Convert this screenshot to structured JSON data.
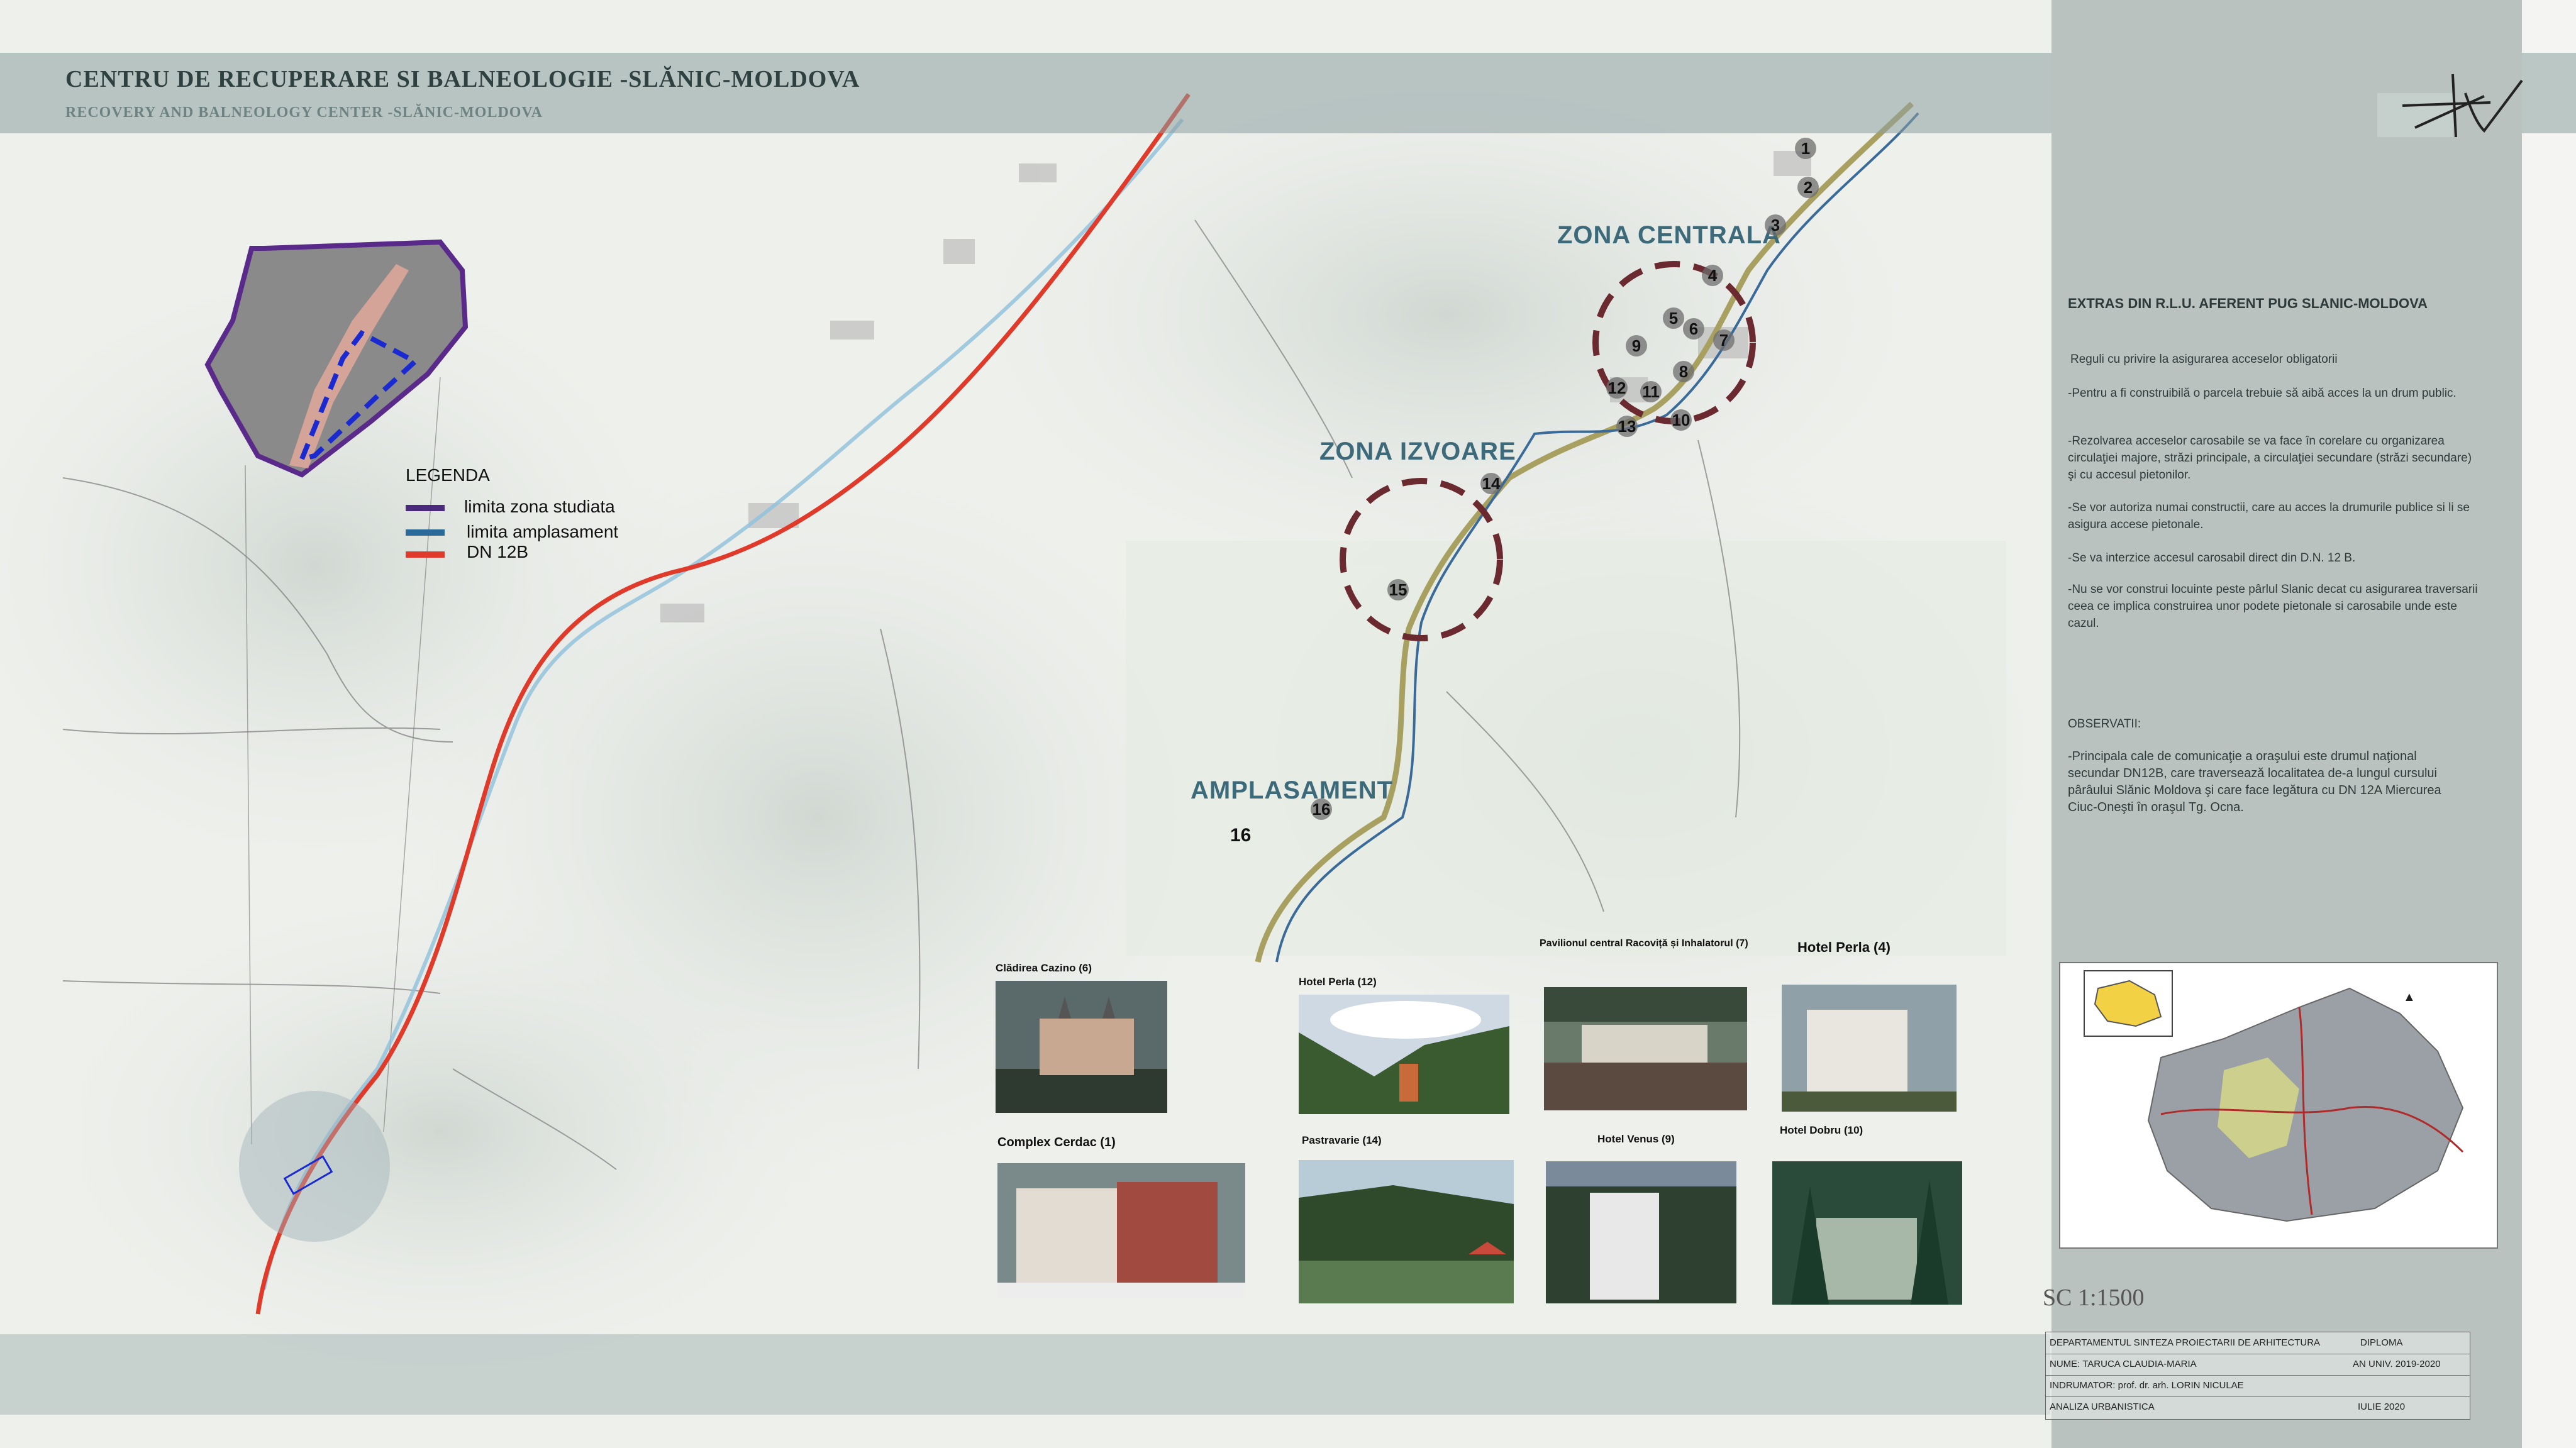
{
  "header": {
    "title": "CENTRU DE RECUPERARE SI BALNEOLOGIE -SLĂNIC-MOLDOVA",
    "subtitle": "RECOVERY AND BALNEOLOGY CENTER -SLĂNIC-MOLDOVA"
  },
  "legend": {
    "title": "LEGENDA",
    "items": [
      {
        "label": "limita zona studiata",
        "color": "#4a2a7a"
      },
      {
        "label": "limita amplasament",
        "color": "#2a6a9a"
      },
      {
        "label": "DN 12B",
        "color": "#e03a2a"
      }
    ]
  },
  "zones": {
    "centrala": "ZONA CENTRALA",
    "izvoare": "ZONA IZVOARE",
    "amplasament": "AMPLASAMENT"
  },
  "markers": [
    "1",
    "2",
    "3",
    "4",
    "5",
    "6",
    "7",
    "8",
    "9",
    "10",
    "11",
    "12",
    "13",
    "14",
    "15",
    "16",
    "16"
  ],
  "photos": [
    {
      "caption": "Clădirea Cazino (6)"
    },
    {
      "caption": "Hotel Perla (12)"
    },
    {
      "caption": "Pavilionul central Racoviță și Inhalatorul (7)"
    },
    {
      "caption": "Hotel Perla (4)"
    },
    {
      "caption": "Complex Cerdac (1)"
    },
    {
      "caption": "Pastravarie (14)"
    },
    {
      "caption": "Hotel Venus (9)"
    },
    {
      "caption": "Hotel Dobru (10)"
    }
  ],
  "panel": {
    "heading": "EXTRAS DIN R.L.U. AFERENT PUG SLANIC-MOLDOVA",
    "p1": "Reguli cu privire la asigurarea acceselor obligatorii",
    "p2": "-Pentru a fi construibilă o parcela trebuie să aibă acces la un drum public.",
    "p3": "-Rezolvarea acceselor carosabile se va face în corelare cu organizarea circulaţiei majore, străzi principale, a circulaţiei secundare (străzi secundare) şi cu accesul pietonilor.",
    "p4": "-Se vor autoriza numai constructii, care au acces la drumurile publice si li se asigura accese pietonale.",
    "p5": "-Se va interzice accesul carosabil direct din D.N. 12 B.",
    "p6": "-Nu se vor construi locuinte peste pârlul Slanic decat cu asigurarea traversarii ceea ce implica construirea unor podete pietonale si carosabile unde este cazul.",
    "obs_title": "OBSERVATII:",
    "obs_text": "-Principala cale de comunicaţie a oraşului este drumul naţional secundar DN12B, care traversează localitatea de-a lungul cursului pârâului Slănic Moldova şi care face legătura cu DN 12A Miercurea Ciuc-Oneşti în oraşul Tg. Ocna."
  },
  "scale": "SC 1:1500",
  "title_block": {
    "department": "DEPARTAMENTUL SINTEZA PROIECTARII DE ARHITECTURA",
    "diploma": "DIPLOMA",
    "name": "NUME: TARUCA CLAUDIA-MARIA",
    "year": "AN UNIV. 2019-2020",
    "advisor": "INDRUMATOR: prof. dr. arh. LORIN NICULAE",
    "analysis": "ANALIZA URBANISTICA",
    "date": "IULIE 2020"
  },
  "colors": {
    "road": "#e03a2a",
    "river": "#5a9ac0",
    "study_boundary": "#4a2a7a",
    "site_boundary": "#1a2ad0",
    "main_road_olive": "#a8a060",
    "zone_circle": "#6a2a30"
  }
}
